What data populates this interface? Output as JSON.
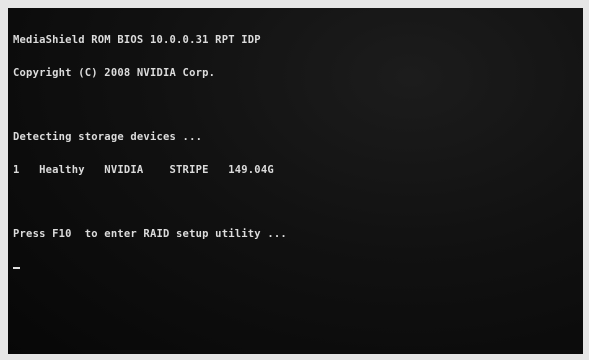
{
  "bios": {
    "title_line": "MediaShield ROM BIOS 10.0.0.31 RPT IDP",
    "copyright_line": "Copyright (C) 2008 NVIDIA Corp.",
    "detecting_line": "Detecting storage devices ...",
    "device_line": "1   Healthy   NVIDIA    STRIPE   149.04G",
    "prompt_line": "Press F10  to enter RAID setup utility ..."
  },
  "colors": {
    "screen_bg": "#111111",
    "text": "#dcdcdc"
  }
}
